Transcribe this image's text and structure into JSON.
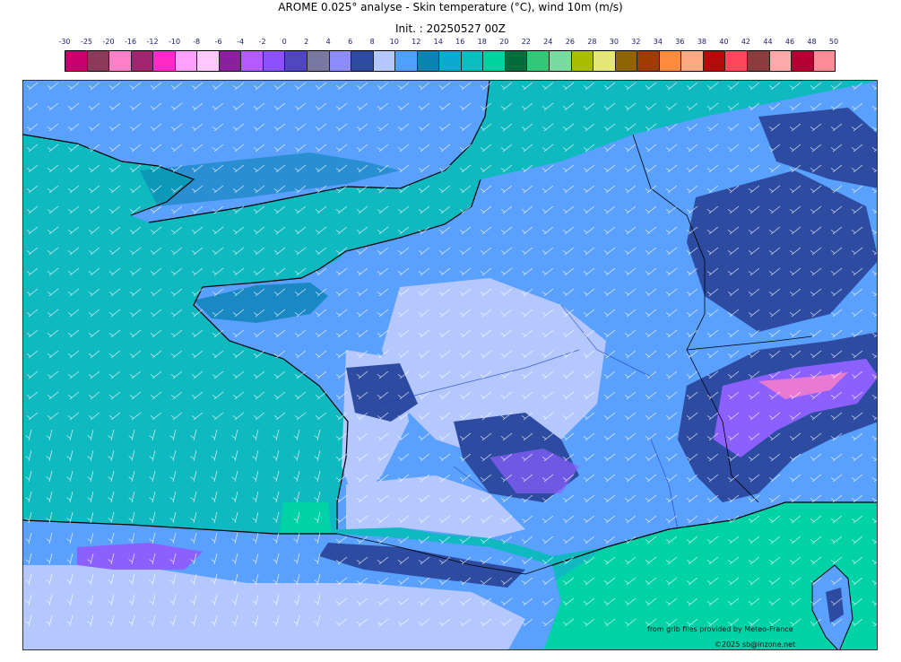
{
  "header": {
    "title": "AROME 0.025° analyse - Skin temperature (°C), wind 10m (m/s)",
    "init": "Init. : 20250527 00Z"
  },
  "legend": {
    "labels": [
      "-30",
      "-25",
      "-20",
      "-16",
      "-12",
      "-10",
      "-8",
      "-6",
      "-4",
      "-2",
      "0",
      "2",
      "4",
      "6",
      "8",
      "10",
      "12",
      "14",
      "16",
      "18",
      "20",
      "22",
      "24",
      "26",
      "28",
      "30",
      "32",
      "34",
      "36",
      "38",
      "40",
      "42",
      "44",
      "46",
      "48",
      "50"
    ],
    "colors": [
      "#c8006e",
      "#8c3a5a",
      "#ff80c8",
      "#a0246e",
      "#ff28c8",
      "#ffa0ff",
      "#ffc8ff",
      "#8c1ea0",
      "#b45aff",
      "#8c50ff",
      "#5046be",
      "#7878a0",
      "#8c8cff",
      "#2d4ba0",
      "#b4c8ff",
      "#50a0ff",
      "#0a82b4",
      "#0aaad2",
      "#0abebe",
      "#00d2a0",
      "#006e3c",
      "#32c878",
      "#78dca0",
      "#aabe00",
      "#e6e678",
      "#8c6400",
      "#a03c00",
      "#ff8c3c",
      "#ffaa82",
      "#b40a0a",
      "#ff465a",
      "#8c3c3c",
      "#ffaaaa",
      "#b40032",
      "#ff8c96"
    ]
  },
  "map": {
    "region": "France and surroundings",
    "land_color": "#5aa0ff",
    "sea_color": "#0fb9c0",
    "warm_sea_color": "#00d2a8",
    "cool_land_color": "#b4c8ff",
    "dark_land_color": "#2d4ba0",
    "mountain_color": "#8c60ff",
    "coast_color": "#000000",
    "wind_barb_color": "#ffffff"
  },
  "credits": {
    "source": "from grib files provided by Meteo-France",
    "copyright": "©2025 sb@inzone.net"
  }
}
